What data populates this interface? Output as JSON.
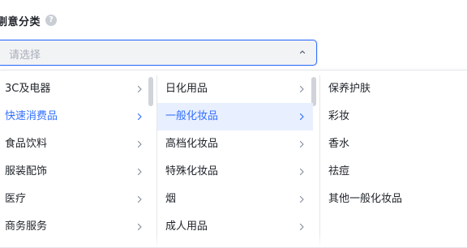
{
  "field": {
    "label": "剔意分类",
    "help_icon": "question-circle-icon",
    "placeholder": "请选择"
  },
  "cascader": {
    "level1": [
      {
        "label": "3C及电器",
        "active": false
      },
      {
        "label": "快速消费品",
        "active": true
      },
      {
        "label": "食品饮料",
        "active": false
      },
      {
        "label": "服装配饰",
        "active": false
      },
      {
        "label": "医疗",
        "active": false
      },
      {
        "label": "商务服务",
        "active": false
      }
    ],
    "level2": [
      {
        "label": "日化用品",
        "active": false
      },
      {
        "label": "一般化妆品",
        "active": true
      },
      {
        "label": "高档化妆品",
        "active": false
      },
      {
        "label": "特殊化妆品",
        "active": false
      },
      {
        "label": "烟",
        "active": false
      },
      {
        "label": "成人用品",
        "active": false
      }
    ],
    "level3": [
      {
        "label": "保养护肤"
      },
      {
        "label": "彩妆"
      },
      {
        "label": "香水"
      },
      {
        "label": "祛痘"
      },
      {
        "label": "其他一般化妆品"
      }
    ]
  },
  "colors": {
    "accent": "#3370ff",
    "highlight_bg": "#e8efff",
    "border": "#e5e6eb",
    "placeholder": "#a9aeb8"
  }
}
